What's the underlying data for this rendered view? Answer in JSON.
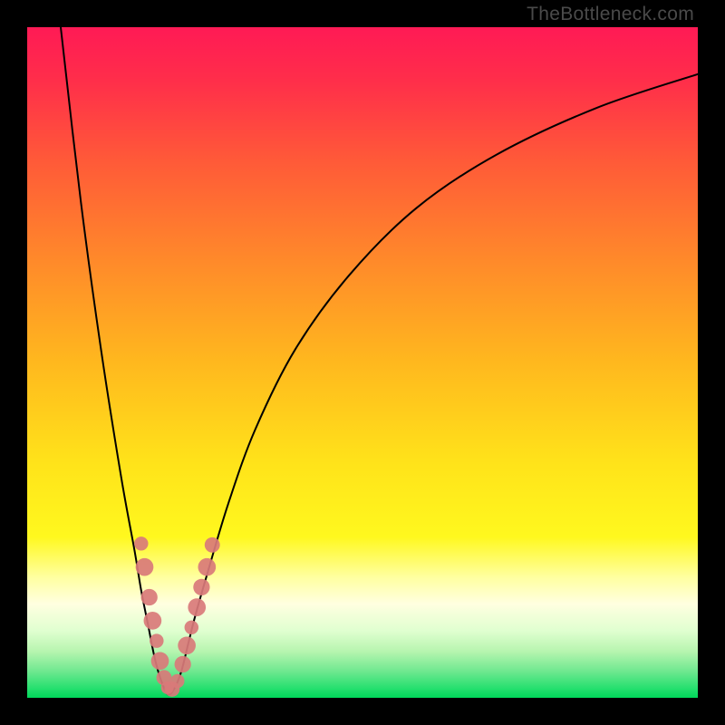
{
  "watermark": "TheBottleneck.com",
  "colors": {
    "frame": "#000000",
    "curve": "#000000",
    "marker_fill": "#d97a7a",
    "gradient_stops": [
      {
        "offset": 0.0,
        "color": "#ff1a55"
      },
      {
        "offset": 0.08,
        "color": "#ff2e4a"
      },
      {
        "offset": 0.2,
        "color": "#ff5a38"
      },
      {
        "offset": 0.35,
        "color": "#ff8a2a"
      },
      {
        "offset": 0.5,
        "color": "#ffb81e"
      },
      {
        "offset": 0.65,
        "color": "#ffe31a"
      },
      {
        "offset": 0.76,
        "color": "#fff81e"
      },
      {
        "offset": 0.82,
        "color": "#ffffa0"
      },
      {
        "offset": 0.86,
        "color": "#ffffe0"
      },
      {
        "offset": 0.9,
        "color": "#e0ffd0"
      },
      {
        "offset": 0.93,
        "color": "#b8f5b0"
      },
      {
        "offset": 0.96,
        "color": "#70e890"
      },
      {
        "offset": 0.985,
        "color": "#28e070"
      },
      {
        "offset": 1.0,
        "color": "#00d85a"
      }
    ]
  },
  "chart_data": {
    "type": "line",
    "title": "",
    "xlabel": "",
    "ylabel": "",
    "xlim": [
      0,
      100
    ],
    "ylim": [
      0,
      100
    ],
    "vertex_x": 21,
    "series": [
      {
        "name": "bottleneck-curve",
        "x": [
          5,
          8,
          11,
          14,
          16,
          17,
          18,
          19,
          20,
          21,
          22,
          23,
          24,
          25,
          27,
          30,
          34,
          40,
          48,
          58,
          70,
          85,
          100
        ],
        "y": [
          100,
          74,
          52,
          33,
          22,
          16,
          11,
          6,
          2.5,
          0.5,
          1.5,
          4,
          8,
          12,
          19,
          29,
          40,
          52,
          63,
          73,
          81,
          88,
          93
        ]
      }
    ],
    "markers": [
      {
        "x": 17.0,
        "y": 23.0,
        "r": 1.1
      },
      {
        "x": 17.5,
        "y": 19.5,
        "r": 1.4
      },
      {
        "x": 18.2,
        "y": 15.0,
        "r": 1.3
      },
      {
        "x": 18.7,
        "y": 11.5,
        "r": 1.4
      },
      {
        "x": 19.3,
        "y": 8.5,
        "r": 1.1
      },
      {
        "x": 19.8,
        "y": 5.5,
        "r": 1.4
      },
      {
        "x": 20.4,
        "y": 3.0,
        "r": 1.2
      },
      {
        "x": 20.9,
        "y": 1.5,
        "r": 1.0
      },
      {
        "x": 21.6,
        "y": 1.3,
        "r": 1.2
      },
      {
        "x": 22.4,
        "y": 2.5,
        "r": 1.1
      },
      {
        "x": 23.2,
        "y": 5.0,
        "r": 1.3
      },
      {
        "x": 23.8,
        "y": 7.8,
        "r": 1.4
      },
      {
        "x": 24.5,
        "y": 10.5,
        "r": 1.1
      },
      {
        "x": 25.3,
        "y": 13.5,
        "r": 1.4
      },
      {
        "x": 26.0,
        "y": 16.5,
        "r": 1.3
      },
      {
        "x": 26.8,
        "y": 19.5,
        "r": 1.4
      },
      {
        "x": 27.6,
        "y": 22.8,
        "r": 1.2
      }
    ]
  }
}
